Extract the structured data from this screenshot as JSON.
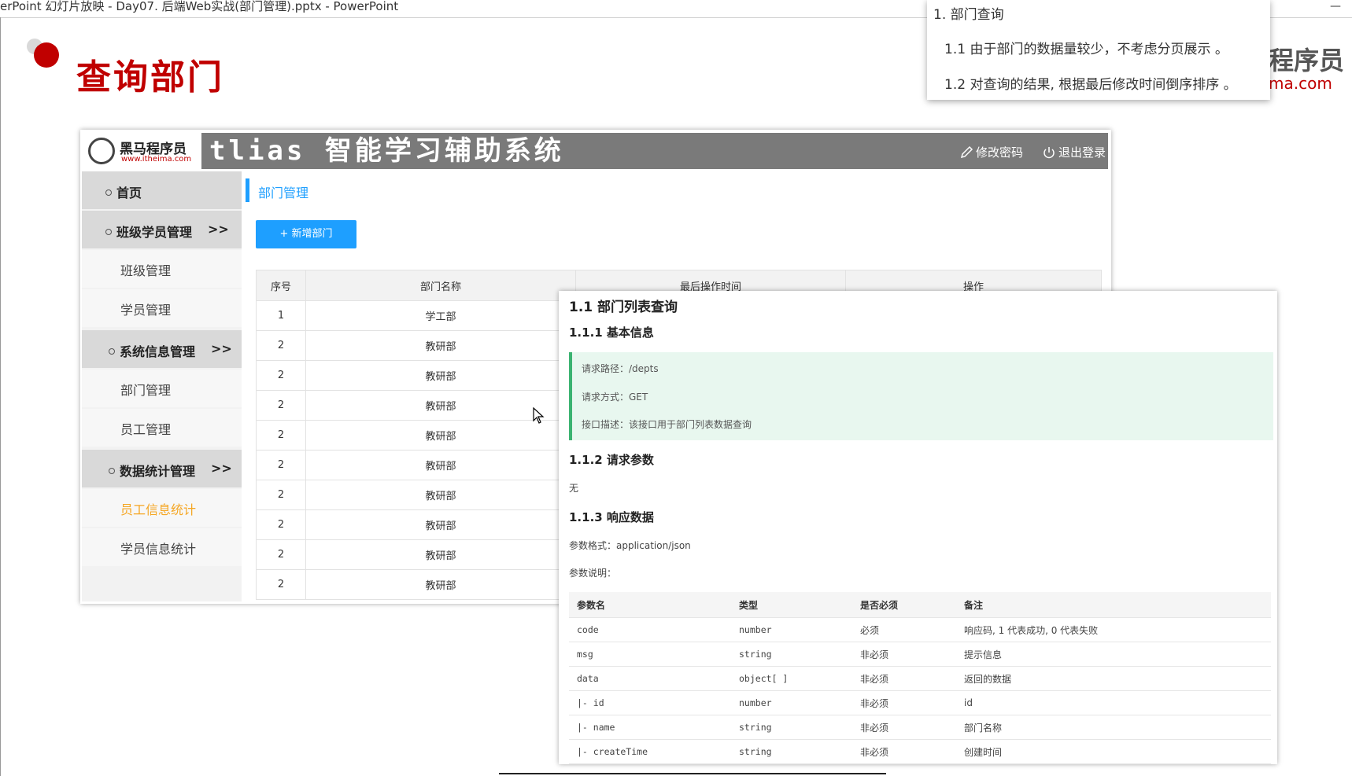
{
  "window": {
    "title": "erPoint 幻灯片放映  -  Day07. 后端Web实战(部门管理).pptx - PowerPoint",
    "minimize_glyph": "—"
  },
  "slide": {
    "title": "查询部门",
    "brand_partial": "程序员",
    "brand_url_partial": "ma.com"
  },
  "note_popup": {
    "line1": "1. 部门查询",
    "line2": "1.1  由于部门的数据量较少，不考虑分页展示 。",
    "line3": "1.2  对查询的结果, 根据最后修改时间倒序排序 。"
  },
  "app": {
    "logo_text": "黑马程序员",
    "logo_url": "www.itheima.com",
    "system_title": "tlias 智能学习辅助系统",
    "change_password": "修改密码",
    "logout": "退出登录",
    "sidebar": {
      "home": "首页",
      "class_group": "班级学员管理",
      "class_group_arrow": ">>",
      "class_mgmt": "班级管理",
      "student_mgmt": "学员管理",
      "sys_group": "系统信息管理",
      "sys_group_arrow": ">>",
      "dept_mgmt": "部门管理",
      "emp_mgmt": "员工管理",
      "stats_group": "数据统计管理",
      "stats_group_arrow": ">>",
      "emp_stats": "员工信息统计",
      "student_stats": "学员信息统计"
    },
    "breadcrumb": "部门管理",
    "add_button": "+ 新增部门",
    "table": {
      "headers": [
        "序号",
        "部门名称",
        "最后操作时间",
        "操作"
      ],
      "rows": [
        [
          "1",
          "学工部"
        ],
        [
          "2",
          "教研部"
        ],
        [
          "2",
          "教研部"
        ],
        [
          "2",
          "教研部"
        ],
        [
          "2",
          "教研部"
        ],
        [
          "2",
          "教研部"
        ],
        [
          "2",
          "教研部"
        ],
        [
          "2",
          "教研部"
        ],
        [
          "2",
          "教研部"
        ],
        [
          "2",
          "教研部"
        ]
      ]
    }
  },
  "doc": {
    "h2": "1.1 部门列表查询",
    "basic_info_title": "1.1.1 基本信息",
    "req_path": "请求路径：/depts",
    "req_method": "请求方式：GET",
    "req_desc": "接口描述：该接口用于部门列表数据查询",
    "params_title": "1.1.2 请求参数",
    "params_none": "无",
    "response_title": "1.1.3 响应数据",
    "param_format": "参数格式：application/json",
    "param_desc": "参数说明：",
    "param_table": {
      "headers": [
        "参数名",
        "类型",
        "是否必须",
        "备注"
      ],
      "rows": [
        [
          "code",
          "number",
          "必须",
          "响应码, 1 代表成功, 0 代表失败"
        ],
        [
          "msg",
          "string",
          "非必须",
          "提示信息"
        ],
        [
          "data",
          "object[ ]",
          "非必须",
          "返回的数据"
        ],
        [
          "|- id",
          "number",
          "非必须",
          "id"
        ],
        [
          "|- name",
          "string",
          "非必须",
          "部门名称"
        ],
        [
          "|- createTime",
          "string",
          "非必须",
          "创建时间"
        ]
      ]
    }
  }
}
